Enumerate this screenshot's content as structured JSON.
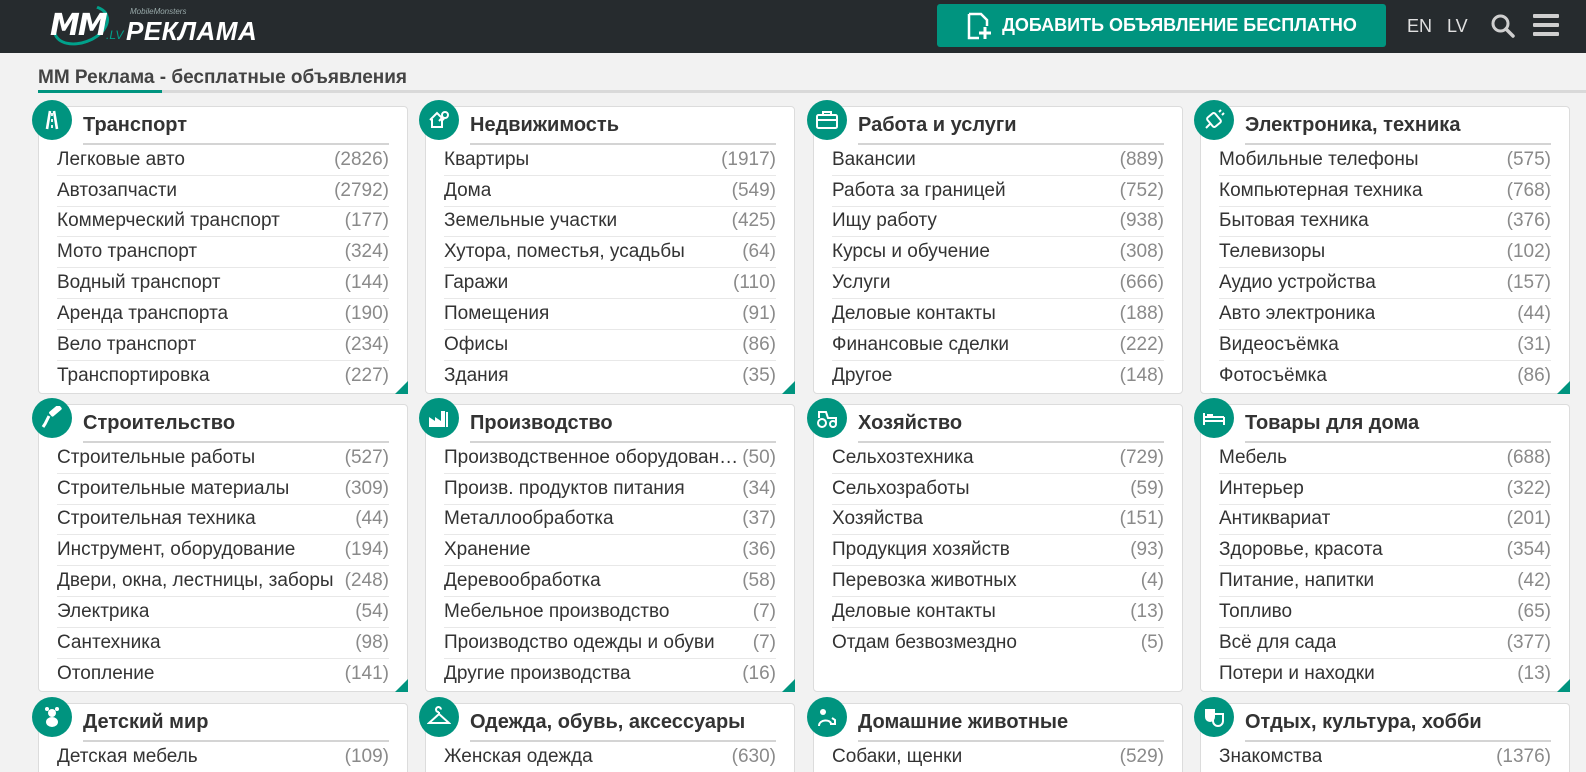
{
  "header": {
    "logo_small": "MobileMonsters",
    "logo_mark": "MM",
    "logo_lv": ".LV",
    "logo_text": "РЕКЛАМА",
    "add_button": "ДОБАВИТЬ ОБЪЯВЛЕНИЕ БЕСПЛАТНО",
    "lang_en": "EN",
    "lang_lv": "LV",
    "accent_color": "#00947f",
    "bar_color": "#262b2e"
  },
  "page_title": "ММ Реклама - бесплатные объявления",
  "categories": [
    {
      "title": "Транспорт",
      "icon": "road-icon",
      "items": [
        {
          "label": "Легковые авто",
          "count": "(2826)"
        },
        {
          "label": "Автозапчасти",
          "count": "(2792)"
        },
        {
          "label": "Коммерческий транспорт",
          "count": "(177)"
        },
        {
          "label": "Мото транспорт",
          "count": "(324)"
        },
        {
          "label": "Водный транспорт",
          "count": "(144)"
        },
        {
          "label": "Аренда транспорта",
          "count": "(190)"
        },
        {
          "label": "Вело транспорт",
          "count": "(234)"
        },
        {
          "label": "Транспортировка",
          "count": "(227)"
        }
      ]
    },
    {
      "title": "Недвижимость",
      "icon": "house-key-icon",
      "items": [
        {
          "label": "Квартиры",
          "count": "(1917)"
        },
        {
          "label": "Дома",
          "count": "(549)"
        },
        {
          "label": "Земельные участки",
          "count": "(425)"
        },
        {
          "label": "Хутора, поместья, усадьбы",
          "count": "(64)"
        },
        {
          "label": "Гаражи",
          "count": "(110)"
        },
        {
          "label": "Помещения",
          "count": "(91)"
        },
        {
          "label": "Офисы",
          "count": "(86)"
        },
        {
          "label": "Здания",
          "count": "(35)"
        }
      ]
    },
    {
      "title": "Работа и услуги",
      "icon": "briefcase-icon",
      "items": [
        {
          "label": "Вакансии",
          "count": "(889)"
        },
        {
          "label": "Работа за границей",
          "count": "(752)"
        },
        {
          "label": "Ищу работу",
          "count": "(938)"
        },
        {
          "label": "Курсы и обучение",
          "count": "(308)"
        },
        {
          "label": "Услуги",
          "count": "(666)"
        },
        {
          "label": "Деловые контакты",
          "count": "(188)"
        },
        {
          "label": "Финансовые сделки",
          "count": "(222)"
        },
        {
          "label": "Другое",
          "count": "(148)"
        }
      ]
    },
    {
      "title": "Электроника, техника",
      "icon": "plug-icon",
      "items": [
        {
          "label": "Мобильные телефоны",
          "count": "(575)"
        },
        {
          "label": "Компьютерная техника",
          "count": "(768)"
        },
        {
          "label": "Бытовая техника",
          "count": "(376)"
        },
        {
          "label": "Телевизоры",
          "count": "(102)"
        },
        {
          "label": "Аудио устройства",
          "count": "(157)"
        },
        {
          "label": "Авто электроника",
          "count": "(44)"
        },
        {
          "label": "Видеосъёмка",
          "count": "(31)"
        },
        {
          "label": "Фотосъёмка",
          "count": "(86)"
        }
      ]
    },
    {
      "title": "Строительство",
      "icon": "paint-roller-icon",
      "items": [
        {
          "label": "Строительные работы",
          "count": "(527)"
        },
        {
          "label": "Строительные материалы",
          "count": "(309)"
        },
        {
          "label": "Строительная техника",
          "count": "(44)"
        },
        {
          "label": "Инструмент, оборудование",
          "count": "(194)"
        },
        {
          "label": "Двери, окна, лестницы, заборы",
          "count": "(248)"
        },
        {
          "label": "Электрика",
          "count": "(54)"
        },
        {
          "label": "Сантехника",
          "count": "(98)"
        },
        {
          "label": "Отопление",
          "count": "(141)"
        }
      ]
    },
    {
      "title": "Производство",
      "icon": "factory-icon",
      "items": [
        {
          "label": "Производственное оборудование",
          "count": "(50)"
        },
        {
          "label": "Произв. продуктов питания",
          "count": "(34)"
        },
        {
          "label": "Металлообработка",
          "count": "(37)"
        },
        {
          "label": "Хранение",
          "count": "(36)"
        },
        {
          "label": "Деревообработка",
          "count": "(58)"
        },
        {
          "label": "Мебельное производство",
          "count": "(7)"
        },
        {
          "label": "Производство одежды и обуви",
          "count": "(7)"
        },
        {
          "label": "Другие производства",
          "count": "(16)"
        }
      ]
    },
    {
      "title": "Хозяйство",
      "icon": "tractor-icon",
      "items": [
        {
          "label": "Сельхозтехника",
          "count": "(729)"
        },
        {
          "label": "Сельхозработы",
          "count": "(59)"
        },
        {
          "label": "Хозяйства",
          "count": "(151)"
        },
        {
          "label": "Продукция хозяйств",
          "count": "(93)"
        },
        {
          "label": "Перевозка животных",
          "count": "(4)"
        },
        {
          "label": "Деловые контакты",
          "count": "(13)"
        },
        {
          "label": "Отдам безвозмездно",
          "count": "(5)"
        }
      ]
    },
    {
      "title": "Товары для дома",
      "icon": "bed-icon",
      "items": [
        {
          "label": "Мебель",
          "count": "(688)"
        },
        {
          "label": "Интерьер",
          "count": "(322)"
        },
        {
          "label": "Антиквариат",
          "count": "(201)"
        },
        {
          "label": "Здоровье, красота",
          "count": "(354)"
        },
        {
          "label": "Питание, напитки",
          "count": "(42)"
        },
        {
          "label": "Топливо",
          "count": "(65)"
        },
        {
          "label": "Всё для сада",
          "count": "(377)"
        },
        {
          "label": "Потери и находки",
          "count": "(13)"
        }
      ]
    },
    {
      "title": "Детский мир",
      "icon": "teddy-bear-icon",
      "items": [
        {
          "label": "Детская мебель",
          "count": "(109)"
        }
      ]
    },
    {
      "title": "Одежда, обувь, аксессуары",
      "icon": "hanger-icon",
      "items": [
        {
          "label": "Женская одежда",
          "count": "(630)"
        }
      ]
    },
    {
      "title": "Домашние животные",
      "icon": "pets-icon",
      "items": [
        {
          "label": "Собаки, щенки",
          "count": "(529)"
        }
      ]
    },
    {
      "title": "Отдых, культура, хобби",
      "icon": "theater-masks-icon",
      "items": [
        {
          "label": "Знакомства",
          "count": "(1376)"
        }
      ]
    }
  ]
}
